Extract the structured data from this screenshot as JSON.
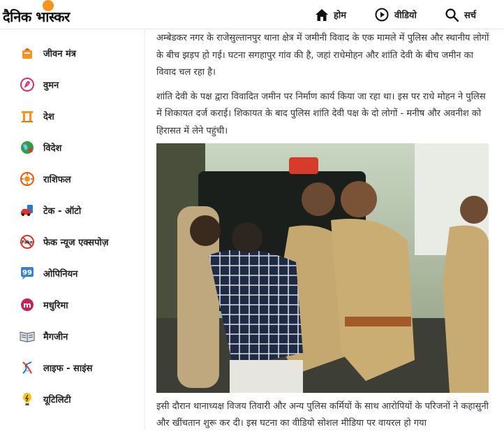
{
  "brand": {
    "logo_text": "दैनिक भास्कर"
  },
  "topnav": [
    {
      "label": "होम",
      "icon": "home-icon"
    },
    {
      "label": "वीडियो",
      "icon": "play-icon"
    },
    {
      "label": "सर्च",
      "icon": "search-icon"
    }
  ],
  "sidebar": {
    "items": [
      {
        "label": "जीवन मंत्र",
        "icon": "jeevan-mantra-icon"
      },
      {
        "label": "वुमन",
        "icon": "woman-icon"
      },
      {
        "label": "देश",
        "icon": "desh-icon"
      },
      {
        "label": "विदेश",
        "icon": "videsh-icon"
      },
      {
        "label": "राशिफल",
        "icon": "rashifal-icon"
      },
      {
        "label": "टेक - ऑटो",
        "icon": "tech-auto-icon"
      },
      {
        "label": "फेक न्यूज एक्सपोज़",
        "icon": "fake-news-icon"
      },
      {
        "label": "ओपिनियन",
        "icon": "opinion-icon"
      },
      {
        "label": "मधुरिमा",
        "icon": "madhurima-icon"
      },
      {
        "label": "मैगजीन",
        "icon": "magazine-icon"
      },
      {
        "label": "लाइफ - साइंस",
        "icon": "life-science-icon"
      },
      {
        "label": "यूटिलिटी",
        "icon": "utility-icon"
      }
    ]
  },
  "article": {
    "para1": "अम्बेडकर नगर के राजेसुल्तानपुर थाना क्षेत्र में जमीनी विवाद के एक मामले में पुलिस और स्थानीय लोगों के बीच झड़प हो गई। घटना सगहापुर गांव की है, जहां राधेमोहन और शांति देवी के बीच जमीन का विवाद चल रहा है।",
    "para2": "शांति देवी के पक्ष द्वारा विवादित जमीन पर निर्माण कार्य किया जा रहा था। इस पर राधे मोहन ने पुलिस में शिकायत दर्ज कराई। शिकायत के बाद पुलिस शांति देवी पक्ष के दो लोगों - मनीष और अवनीश को हिरासत में लेने पहुंची।",
    "para3": "इसी दौरान थानाध्यक्ष विजय तिवारी और अन्य पुलिस कर्मियों के साथ आरोपियों के परिजनों ने कहासुनी और खींचतान शुरू कर दी। इस घटना का वीडियो सोशल मीडिया पर वायरल हो गया"
  },
  "colors": {
    "brand_orange": "#f7941d",
    "text": "#333333"
  }
}
